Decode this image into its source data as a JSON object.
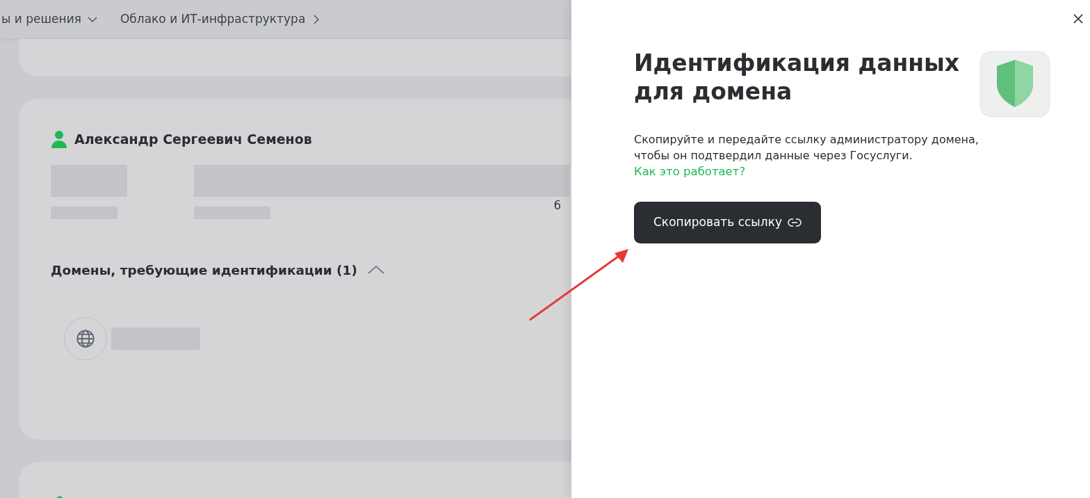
{
  "nav": {
    "items": [
      {
        "label": "ы и решения",
        "kind": "dropdown"
      },
      {
        "label": "Облако и ИТ-инфраструктура",
        "kind": "submenu"
      }
    ]
  },
  "contact": {
    "name": "Александр Сергеевич Семенов",
    "cut_text": "б",
    "domains_heading": "Домены, требующие идентификации (1)",
    "expanded": true
  },
  "drawer": {
    "title": "Идентификация данных для домена",
    "description": "Скопируйте и передайте ссылку администратору домена, чтобы он подтвердил данные через Госуслуги.",
    "link": "Как это работает?",
    "button": "Скопировать ссылку"
  }
}
